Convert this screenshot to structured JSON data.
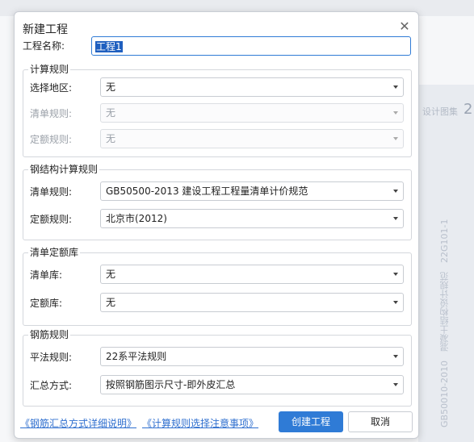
{
  "background": {
    "right_label": "设计图集",
    "right_number": "2",
    "right_vertical_text": "GB50010-2010　混凝土结构设计规范　22G101-1"
  },
  "dialog": {
    "title": "新建工程",
    "close_icon": "close-icon",
    "project_name_label": "工程名称:",
    "project_name_value": "工程1"
  },
  "groups": {
    "calc_rules": {
      "title": "计算规则",
      "region_label": "选择地区:",
      "region_value": "无",
      "bill_rule_label": "清单规则:",
      "bill_rule_value": "无",
      "quota_rule_label": "定额规则:",
      "quota_rule_value": "无"
    },
    "steel_calc_rules": {
      "title": "钢结构计算规则",
      "bill_rule_label": "清单规则:",
      "bill_rule_value": "GB50500-2013 建设工程工程量清单计价规范",
      "quota_rule_label": "定额规则:",
      "quota_rule_value": "北京市(2012)"
    },
    "bill_quota_lib": {
      "title": "清单定额库",
      "bill_lib_label": "清单库:",
      "bill_lib_value": "无",
      "quota_lib_label": "定额库:",
      "quota_lib_value": "无"
    },
    "rebar_rules": {
      "title": "钢筋规则",
      "flat_rule_label": "平法规则:",
      "flat_rule_value": "22系平法规则",
      "summary_label": "汇总方式:",
      "summary_value": "按照钢筋图示尺寸-即外皮汇总"
    }
  },
  "footer": {
    "link_rebar": "《钢筋汇总方式详细说明》",
    "link_calc": "《计算规则选择注意事项》",
    "create_button": "创建工程",
    "cancel_button": "取消"
  },
  "colors": {
    "accent": "#2f7bd6",
    "link": "#2f6fcf",
    "disabled_text": "#9aa0a8"
  }
}
